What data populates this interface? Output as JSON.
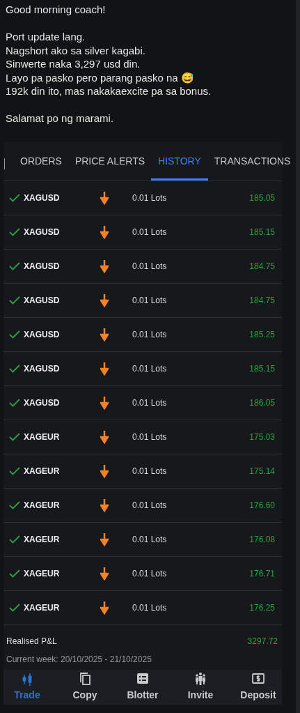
{
  "message": {
    "paragraphs": [
      [
        "Good morning coach!"
      ],
      [
        "Port update lang.",
        "Nagshort ako sa silver kagabi.",
        "Sinwerte naka 3,297 usd din.",
        "Layo pa pasko pero parang pasko na 😅",
        "192k din ito, mas nakakaexcite pa sa bonus."
      ],
      [
        "Salamat po ng marami."
      ]
    ]
  },
  "tabs": [
    {
      "label": "ORDERS",
      "selected": false
    },
    {
      "label": "PRICE ALERTS",
      "selected": false
    },
    {
      "label": "HISTORY",
      "selected": true
    },
    {
      "label": "TRANSACTIONS",
      "selected": false
    }
  ],
  "trades": [
    {
      "symbol": "XAGUSD",
      "short": true,
      "lots": "0.01 Lots",
      "pnl": "185.05"
    },
    {
      "symbol": "XAGUSD",
      "short": true,
      "lots": "0.01 Lots",
      "pnl": "185.15"
    },
    {
      "symbol": "XAGUSD",
      "short": true,
      "lots": "0.01 Lots",
      "pnl": "184.75"
    },
    {
      "symbol": "XAGUSD",
      "short": true,
      "lots": "0.01 Lots",
      "pnl": "184.75"
    },
    {
      "symbol": "XAGUSD",
      "short": true,
      "lots": "0.01 Lots",
      "pnl": "185.25"
    },
    {
      "symbol": "XAGUSD",
      "short": true,
      "lots": "0.01 Lots",
      "pnl": "185.15"
    },
    {
      "symbol": "XAGUSD",
      "short": true,
      "lots": "0.01 Lots",
      "pnl": "186.05"
    },
    {
      "symbol": "XAGEUR",
      "short": true,
      "lots": "0.01 Lots",
      "pnl": "175.03"
    },
    {
      "symbol": "XAGEUR",
      "short": true,
      "lots": "0.01 Lots",
      "pnl": "175.14"
    },
    {
      "symbol": "XAGEUR",
      "short": true,
      "lots": "0.01 Lots",
      "pnl": "176.60"
    },
    {
      "symbol": "XAGEUR",
      "short": true,
      "lots": "0.01 Lots",
      "pnl": "176.08"
    },
    {
      "symbol": "XAGEUR",
      "short": true,
      "lots": "0.01 Lots",
      "pnl": "176.71"
    },
    {
      "symbol": "XAGEUR",
      "short": true,
      "lots": "0.01 Lots",
      "pnl": "176.25"
    }
  ],
  "summary": {
    "label": "Realised P&L",
    "value": "3297.72",
    "period": "Current week: 20/10/2025 - 21/10/2025"
  },
  "bottom_nav": [
    {
      "label": "Trade",
      "selected": true
    },
    {
      "label": "Copy",
      "selected": false
    },
    {
      "label": "Blotter",
      "selected": false
    },
    {
      "label": "Invite",
      "selected": false
    },
    {
      "label": "Deposit",
      "selected": false
    }
  ]
}
